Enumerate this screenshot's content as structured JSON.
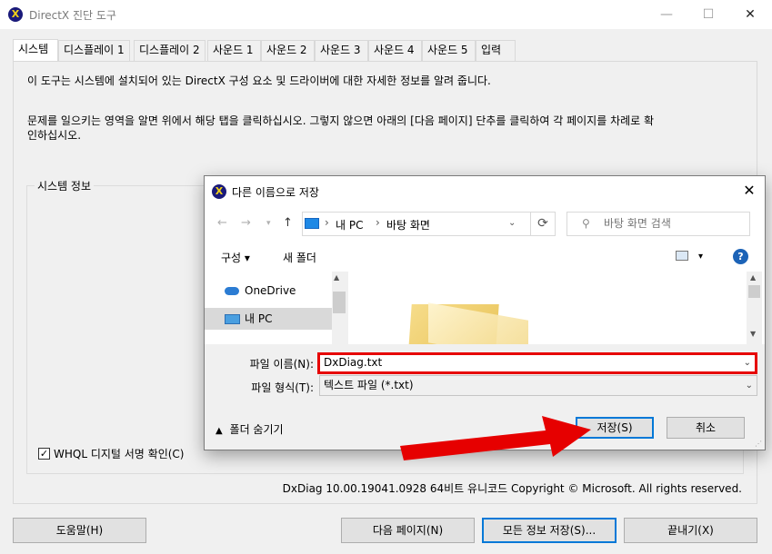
{
  "window": {
    "title": "DirectX 진단 도구",
    "minimize": "—",
    "maximize": "☐",
    "close": "✕"
  },
  "tabs": [
    "시스템",
    "디스플레이 1",
    "디스플레이 2",
    "사운드 1",
    "사운드 2",
    "사운드 3",
    "사운드 4",
    "사운드 5",
    "입력"
  ],
  "intro": {
    "line1": "이 도구는 시스템에 설치되어 있는 DirectX 구성 요소 및 드라이버에 대한 자세한 정보를 알려 줍니다.",
    "line2a": "문제를 일으키는 영역을 알면 위에서 해당 탭을 클릭하십시오. 그렇지 않으면 아래의 [다음 페이지] 단추를 클릭하여 각 페이지를 차례로 확",
    "line2b": "인하십시오."
  },
  "system_info": {
    "group_label": "시스템 정보"
  },
  "whql_label": "WHQL 디지털 서명 확인(C)",
  "whql_checked": true,
  "version_text": "DxDiag 10.00.19041.0928 64비트 유니코드  Copyright © Microsoft. All rights reserved.",
  "buttons": {
    "help": "도움말(H)",
    "next_page": "다음 페이지(N)",
    "save_all": "모든 정보 저장(S)...",
    "exit": "끝내기(X)"
  },
  "dialog": {
    "title": "다른 이름으로 저장",
    "close": "✕",
    "breadcrumb": [
      "내 PC",
      "바탕 화면"
    ],
    "search_placeholder": "바탕 화면 검색",
    "organize": "구성 ▾",
    "new_folder": "새 폴더",
    "nav_items": [
      {
        "label": "OneDrive",
        "selected": false
      },
      {
        "label": "내 PC",
        "selected": true
      }
    ],
    "file_name_label": "파일 이름(N):",
    "file_name_value": "DxDiag.txt",
    "file_type_label": "파일 형식(T):",
    "file_type_value": "텍스트 파일 (*.txt)",
    "hide_folders": "폴더 숨기기",
    "save": "저장(S)",
    "cancel": "취소"
  },
  "colors": {
    "accent": "#0078d7",
    "highlight": "#e60000",
    "arrow": "#e60000"
  }
}
